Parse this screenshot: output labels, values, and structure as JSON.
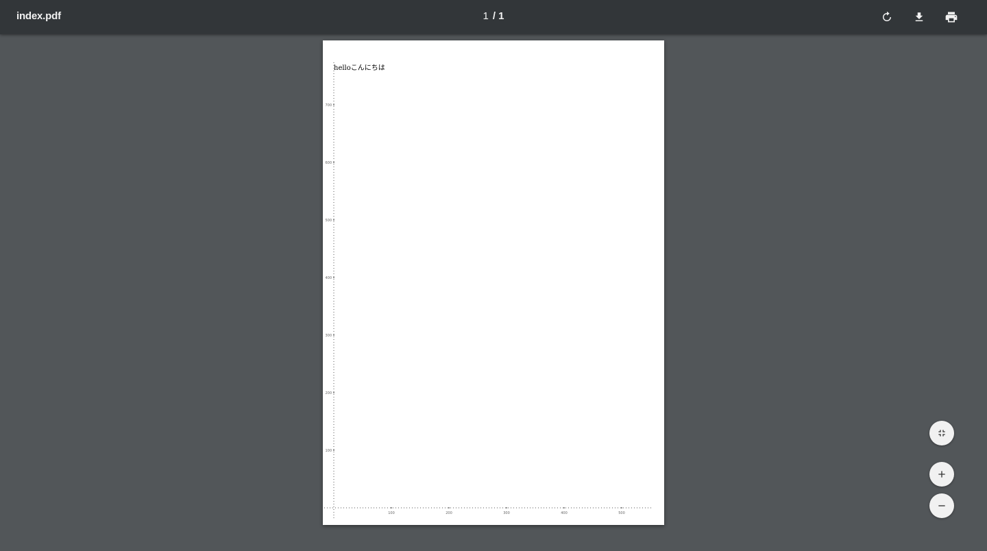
{
  "toolbar": {
    "title": "index.pdf",
    "page_current": "1",
    "page_separator": "/",
    "page_total": "1",
    "buttons": [
      {
        "name": "rotate-button",
        "icon": "rotate-icon"
      },
      {
        "name": "download-button",
        "icon": "download-icon"
      },
      {
        "name": "print-button",
        "icon": "print-icon"
      }
    ]
  },
  "document": {
    "text": "helloこんにちは",
    "ruler": {
      "y_ticks": [
        "700",
        "600",
        "500",
        "400",
        "300",
        "200",
        "100"
      ],
      "x_ticks": [
        "100",
        "200",
        "300",
        "400",
        "500"
      ]
    }
  },
  "zoom_controls": [
    {
      "name": "fit-to-page-button",
      "icon": "fit-to-page-icon"
    },
    {
      "name": "zoom-in-button",
      "icon": "plus-icon"
    },
    {
      "name": "zoom-out-button",
      "icon": "minus-icon"
    }
  ],
  "colors": {
    "toolbar": "#323639",
    "background": "#525659",
    "page": "#ffffff",
    "fab": "#f1f1f1"
  }
}
